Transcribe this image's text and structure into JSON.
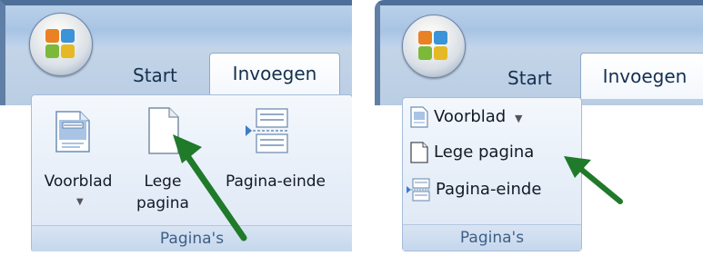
{
  "left": {
    "tabs": {
      "start": "Start",
      "invoegen": "Invoegen"
    },
    "buttons": {
      "voorblad": "Voorblad",
      "lege_line1": "Lege",
      "lege_line2": "pagina",
      "pagina_einde": "Pagina-einde"
    },
    "group_label": "Pagina's",
    "arrow_color": "#1f7a2a"
  },
  "right": {
    "tabs": {
      "start": "Start",
      "invoegen": "Invoegen"
    },
    "buttons": {
      "voorblad": "Voorblad",
      "lege_pagina": "Lege pagina",
      "pagina_einde": "Pagina-einde"
    },
    "group_label": "Pagina's",
    "arrow_color": "#1f7a2a"
  }
}
